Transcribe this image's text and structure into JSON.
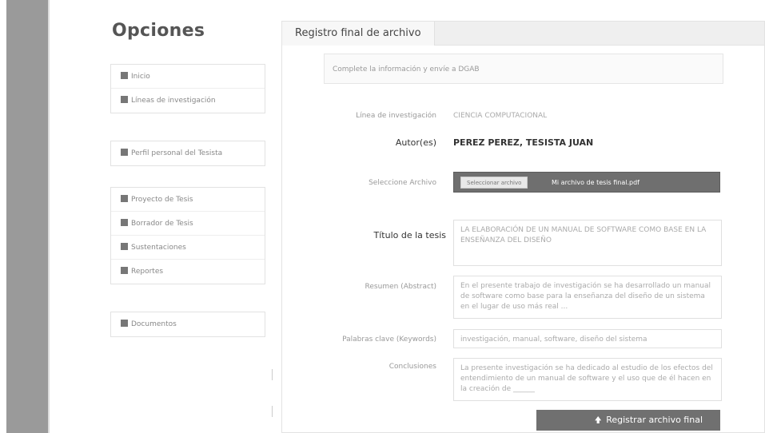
{
  "sidebar": {
    "title": "Opciones",
    "groups": [
      {
        "items": [
          {
            "label": "Inicio"
          },
          {
            "label": "Líneas de investigación"
          }
        ]
      },
      {
        "items": [
          {
            "label": "Perfil personal del Tesista"
          }
        ]
      },
      {
        "items": [
          {
            "label": "Proyecto de Tesis"
          },
          {
            "label": "Borrador de Tesis"
          },
          {
            "label": "Sustentaciones"
          },
          {
            "label": "Reportes"
          }
        ]
      },
      {
        "items": [
          {
            "label": "Documentos"
          }
        ]
      }
    ]
  },
  "panel": {
    "tab": "Registro final de archivo",
    "notice": "Complete la información y envíe a DGAB"
  },
  "form": {
    "linea_label": "Línea de investigación",
    "linea_value": "CIENCIA COMPUTACIONAL",
    "autor_label": "Autor(es)",
    "autor_value": "PEREZ PEREZ, TESISTA JUAN",
    "archivo_label": "Seleccione Archivo",
    "archivo_button": "Seleccionar archivo",
    "archivo_name": "Mi archivo de tesis final.pdf",
    "titulo_label": "Título de la tesis",
    "titulo_value": "LA ELABORACIÓN DE UN MANUAL DE SOFTWARE COMO BASE EN LA ENSEÑANZA DEL DISEÑO",
    "resumen_label": "Resumen (Abstract)",
    "resumen_value": "En el presente trabajo de investigación se ha desarrollado un manual de software como base para la enseñanza del diseño de un sistema en el lugar de uso más real ...",
    "palabras_label": "Palabras clave (Keywords)",
    "palabras_value": "investigación, manual, software, diseño del sistema",
    "conclusiones_label": "Conclusiones",
    "conclusiones_value": "La presente investigación se ha dedicado al estudio de los efectos del entendimiento de un manual de software y el uso que de él hacen en la creación de ______",
    "submit": "Registrar archivo final"
  }
}
